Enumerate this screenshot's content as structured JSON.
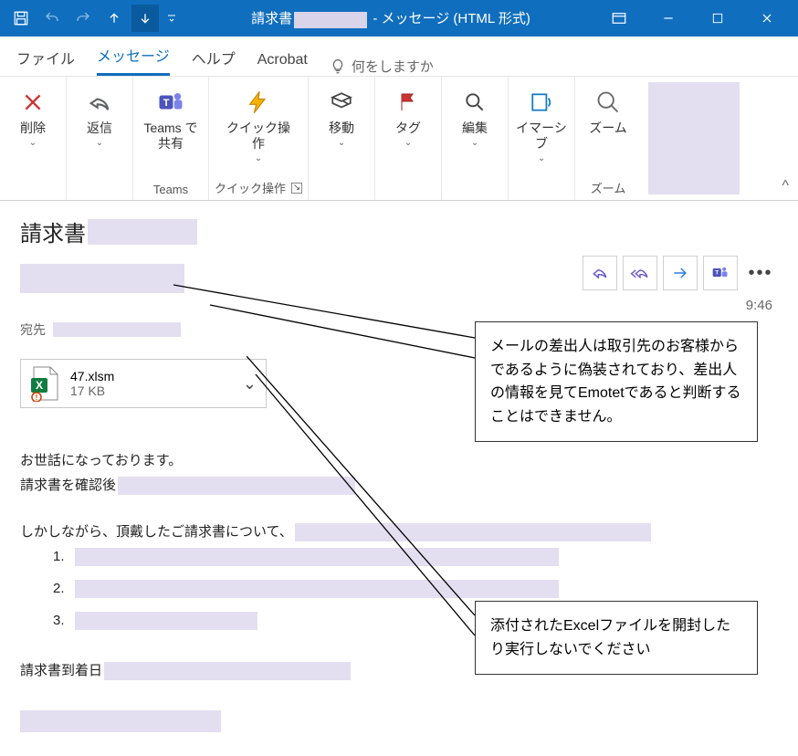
{
  "titlebar": {
    "prefix": "請求書",
    "suffix": "- メッセージ (HTML 形式)"
  },
  "tabs": {
    "file": "ファイル",
    "message": "メッセージ",
    "help": "ヘルプ",
    "acrobat": "Acrobat",
    "tellme": "何をしますか"
  },
  "ribbon": {
    "delete": "削除",
    "reply": "返信",
    "teams_share": "Teams で共有",
    "teams_group": "Teams",
    "quick": "クイック操作",
    "quick_group": "クイック操作",
    "move": "移動",
    "tag": "タグ",
    "edit": "編集",
    "immersive": "イマーシブ",
    "zoom": "ズーム",
    "zoom_group": "ズーム"
  },
  "message": {
    "subject_prefix": "請求書",
    "to_label": "宛先",
    "timestamp": "9:46",
    "attachment_name": "47.xlsm",
    "attachment_size": "17 KB"
  },
  "body": {
    "l1": "お世話になっております。",
    "l2": "請求書を確認後",
    "l4": "しかしながら、頂戴したご請求書について、",
    "n1": "1.",
    "n2": "2.",
    "n3": "3.",
    "l5": "請求書到着日"
  },
  "annotations": {
    "callout1": "メールの差出人は取引先のお客様からであるように偽装されており、差出人の情報を見てEmotetであると判断することはできません。",
    "callout2": "添付されたExcelファイルを開封したり実行しないでください"
  }
}
